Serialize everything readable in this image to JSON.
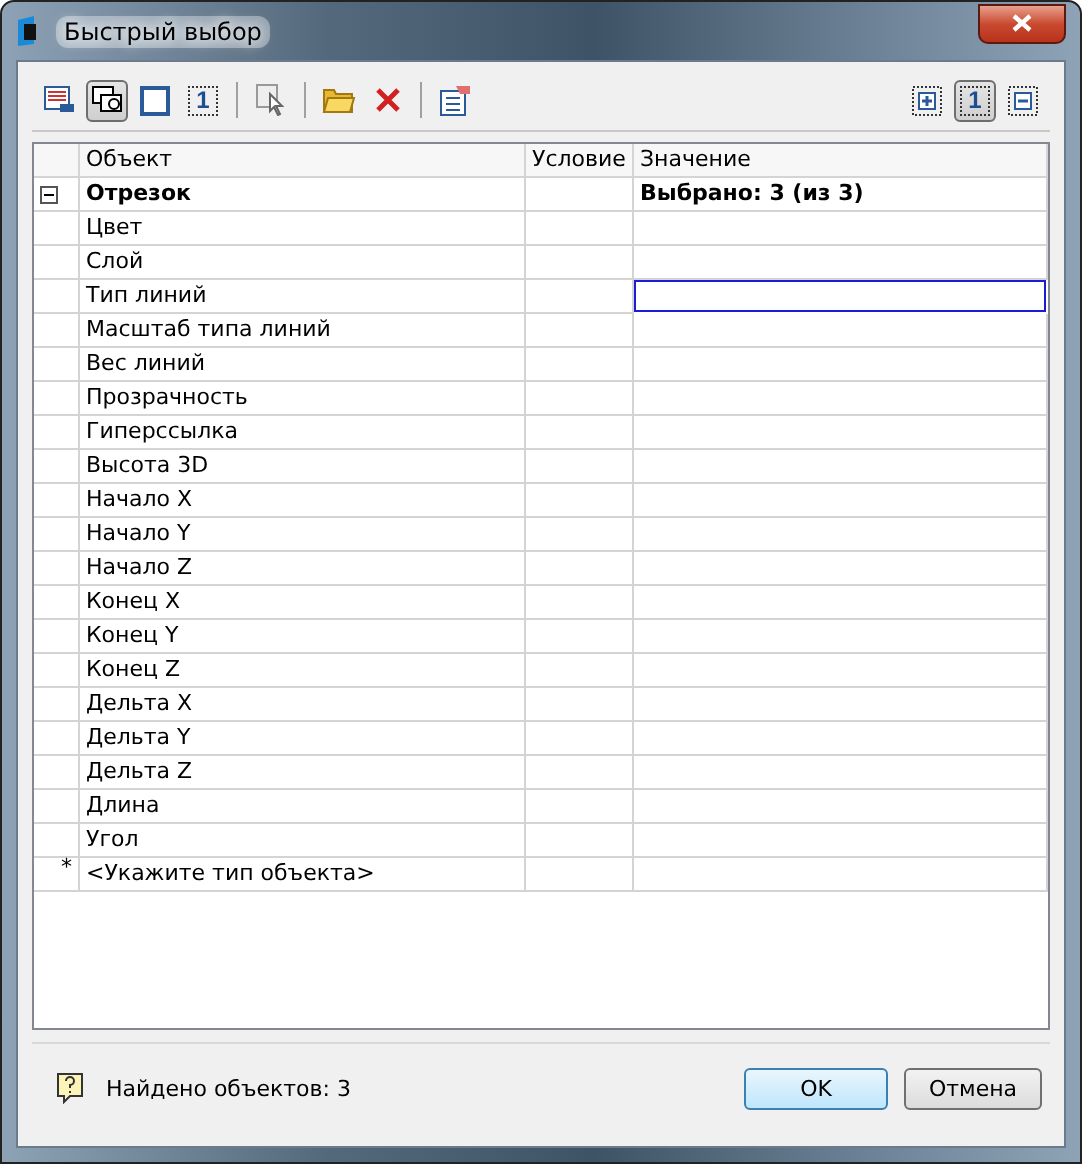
{
  "window": {
    "title": "Быстрый выбор"
  },
  "toolbar": {
    "left": [
      {
        "kind": "sheet",
        "pressed": false
      },
      {
        "kind": "windows",
        "pressed": true
      },
      {
        "kind": "square",
        "pressed": false
      },
      {
        "kind": "number",
        "glyph": "1",
        "pressed": false
      },
      {
        "kind": "separator"
      },
      {
        "kind": "pick",
        "pressed": false
      },
      {
        "kind": "separator"
      },
      {
        "kind": "folder",
        "pressed": false
      },
      {
        "kind": "cross",
        "pressed": false
      },
      {
        "kind": "separator"
      },
      {
        "kind": "form",
        "pressed": false
      }
    ],
    "right": [
      {
        "kind": "plus",
        "pressed": false
      },
      {
        "kind": "number",
        "glyph": "1",
        "pressed": true
      },
      {
        "kind": "minus",
        "pressed": false
      }
    ]
  },
  "table": {
    "columns": [
      "Объект",
      "Условие",
      "Значение"
    ],
    "group": {
      "name": "Отрезок",
      "value": "Выбрано: 3 (из 3)",
      "expanded": true
    },
    "rows": [
      {
        "name": "Цвет",
        "focused": false
      },
      {
        "name": "Слой",
        "focused": false
      },
      {
        "name": "Тип линий",
        "focused": true
      },
      {
        "name": "Масштаб типа линий",
        "focused": false
      },
      {
        "name": "Вес линий",
        "focused": false
      },
      {
        "name": "Прозрачность",
        "focused": false
      },
      {
        "name": "Гиперссылка",
        "focused": false
      },
      {
        "name": "Высота 3D",
        "focused": false
      },
      {
        "name": "Начало X",
        "focused": false
      },
      {
        "name": "Начало Y",
        "focused": false
      },
      {
        "name": "Начало Z",
        "focused": false
      },
      {
        "name": "Конец X",
        "focused": false
      },
      {
        "name": "Конец Y",
        "focused": false
      },
      {
        "name": "Конец Z",
        "focused": false
      },
      {
        "name": "Дельта X",
        "focused": false
      },
      {
        "name": "Дельта Y",
        "focused": false
      },
      {
        "name": "Дельта Z",
        "focused": false
      },
      {
        "name": "Длина",
        "focused": false
      },
      {
        "name": "Угол",
        "focused": false
      }
    ],
    "new_row": {
      "marker": "*",
      "name": "<Укажите тип объекта>"
    }
  },
  "footer": {
    "status": "Найдено объектов: 3",
    "buttons": [
      {
        "label": "OK",
        "default": true
      },
      {
        "label": "Отмена",
        "default": false
      }
    ]
  }
}
